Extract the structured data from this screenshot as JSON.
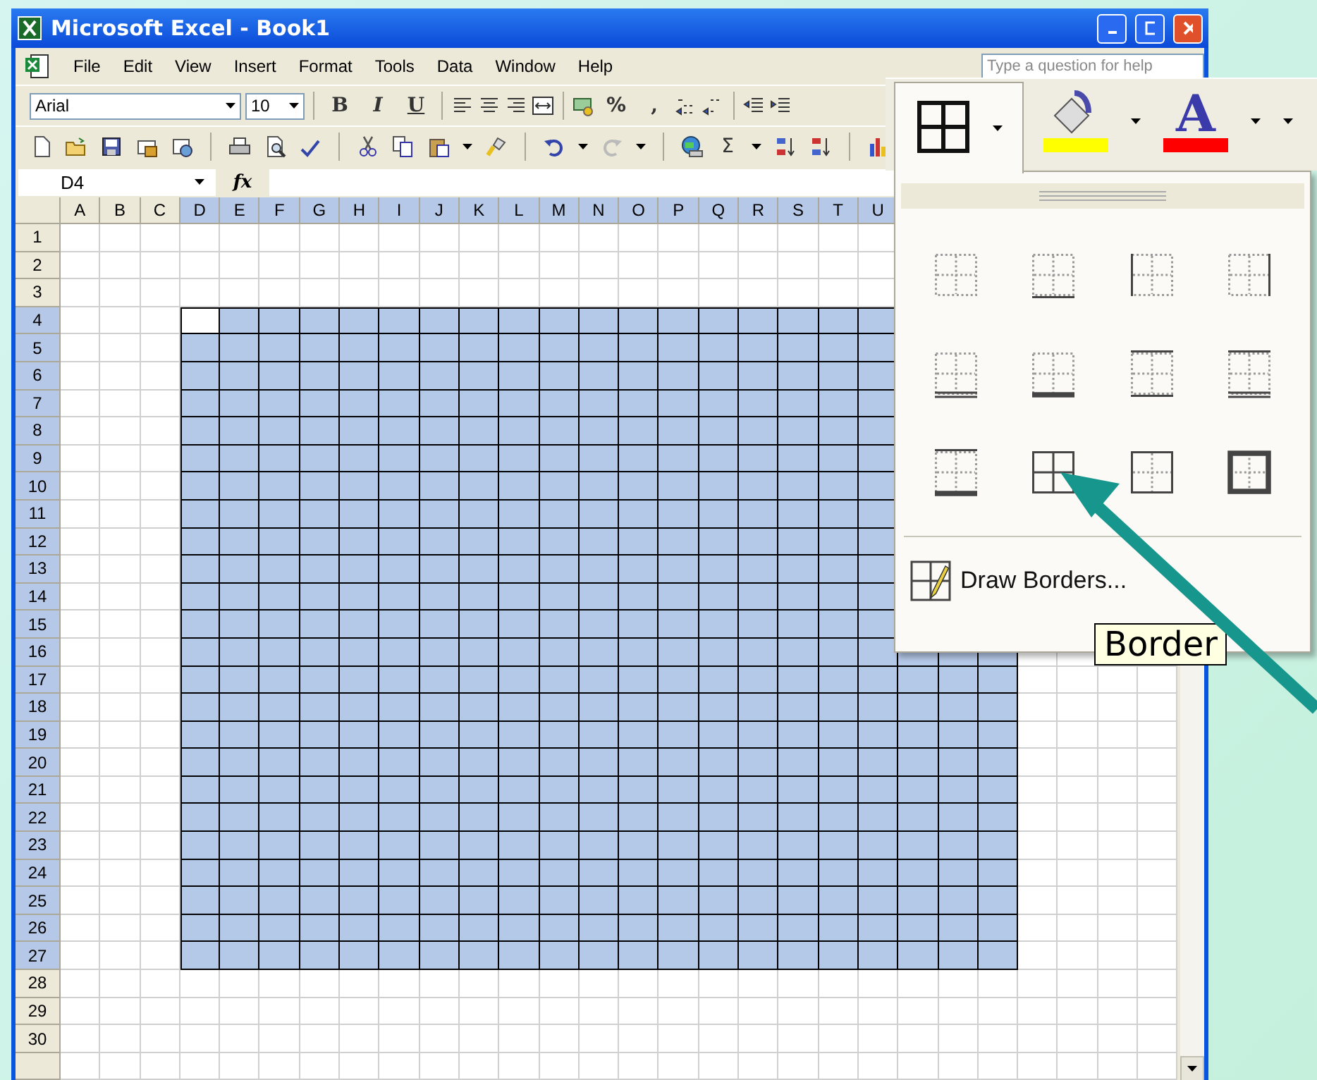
{
  "window": {
    "title": "Microsoft Excel - Book1"
  },
  "menu": [
    "File",
    "Edit",
    "View",
    "Insert",
    "Format",
    "Tools",
    "Data",
    "Window",
    "Help"
  ],
  "help_box": {
    "placeholder": "Type a question for help"
  },
  "formatting_toolbar": {
    "font": "Arial",
    "size": "10",
    "bold": "B",
    "italic": "I",
    "underline": "U",
    "percent": "%",
    "comma": ","
  },
  "standard_toolbar": {
    "autosum": "Σ"
  },
  "name_box": {
    "value": "D4"
  },
  "formula_bar": {
    "function_label": "fx"
  },
  "sheet": {
    "columns": [
      {
        "label": "A",
        "selected": false
      },
      {
        "label": "B",
        "selected": false
      },
      {
        "label": "C",
        "selected": false
      },
      {
        "label": "D",
        "selected": true
      },
      {
        "label": "E",
        "selected": true
      },
      {
        "label": "F",
        "selected": true
      },
      {
        "label": "G",
        "selected": true
      },
      {
        "label": "H",
        "selected": true
      },
      {
        "label": "I",
        "selected": true
      },
      {
        "label": "J",
        "selected": true
      },
      {
        "label": "K",
        "selected": true
      },
      {
        "label": "L",
        "selected": true
      },
      {
        "label": "M",
        "selected": true
      },
      {
        "label": "N",
        "selected": true
      },
      {
        "label": "O",
        "selected": true
      },
      {
        "label": "P",
        "selected": true
      },
      {
        "label": "Q",
        "selected": true
      },
      {
        "label": "R",
        "selected": true
      },
      {
        "label": "S",
        "selected": true
      },
      {
        "label": "T",
        "selected": true
      },
      {
        "label": "U",
        "selected": true
      },
      {
        "selected": true
      },
      {
        "selected": true
      },
      {
        "selected": true
      },
      {
        "selected": false
      },
      {
        "selected": false
      },
      {
        "selected": false
      },
      {
        "selected": false
      }
    ],
    "rows": [
      {
        "label": "1",
        "selected": false
      },
      {
        "label": "2",
        "selected": false
      },
      {
        "label": "3",
        "selected": false
      },
      {
        "label": "4",
        "selected": true
      },
      {
        "label": "5",
        "selected": true
      },
      {
        "label": "6",
        "selected": true
      },
      {
        "label": "7",
        "selected": true
      },
      {
        "label": "8",
        "selected": true
      },
      {
        "label": "9",
        "selected": true
      },
      {
        "label": "10",
        "selected": true
      },
      {
        "label": "11",
        "selected": true
      },
      {
        "label": "12",
        "selected": true
      },
      {
        "label": "13",
        "selected": true
      },
      {
        "label": "14",
        "selected": true
      },
      {
        "label": "15",
        "selected": true
      },
      {
        "label": "16",
        "selected": true
      },
      {
        "label": "17",
        "selected": true
      },
      {
        "label": "18",
        "selected": true
      },
      {
        "label": "19",
        "selected": true
      },
      {
        "label": "20",
        "selected": true
      },
      {
        "label": "21",
        "selected": true
      },
      {
        "label": "22",
        "selected": true
      },
      {
        "label": "23",
        "selected": true
      },
      {
        "label": "24",
        "selected": true
      },
      {
        "label": "25",
        "selected": true
      },
      {
        "label": "26",
        "selected": true
      },
      {
        "label": "27",
        "selected": true
      },
      {
        "label": "28",
        "selected": false
      },
      {
        "label": "29",
        "selected": false
      },
      {
        "label": "30",
        "selected": false
      },
      {
        "selected": false
      }
    ]
  },
  "borders_popup": {
    "font_color_label": "A",
    "options": [
      {
        "kind": "none"
      },
      {
        "kind": "bottom"
      },
      {
        "kind": "left"
      },
      {
        "kind": "right"
      },
      {
        "kind": "bottom-double"
      },
      {
        "kind": "bottom-thick"
      },
      {
        "kind": "top-bottom"
      },
      {
        "kind": "top-double-bottom"
      },
      {
        "kind": "top-thick-bottom"
      },
      {
        "kind": "all"
      },
      {
        "kind": "outside"
      },
      {
        "kind": "thick-outside"
      }
    ],
    "draw_borders": "Draw Borders...",
    "tooltip": "Border"
  }
}
